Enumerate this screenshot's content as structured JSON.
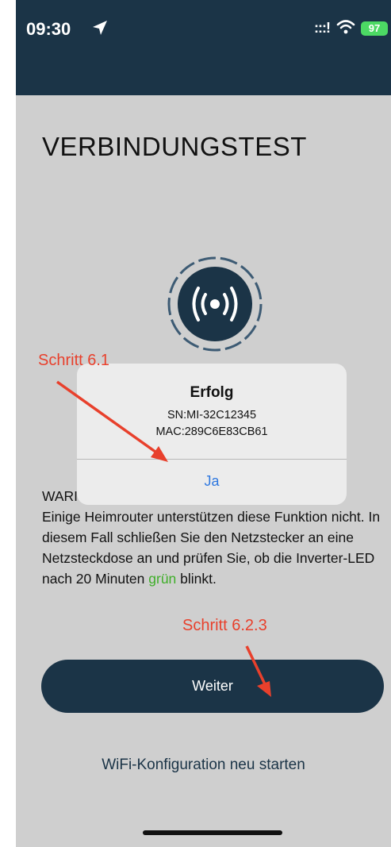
{
  "status_bar": {
    "time": "09:30",
    "signal": ":::!",
    "battery": "97"
  },
  "page": {
    "title": "VERBINDUNGSTEST"
  },
  "annotations": {
    "step_1": "Schritt 6.1",
    "step_2": "Schritt 6.2.3"
  },
  "dialog": {
    "title": "Erfolg",
    "sn": "SN:MI-32C12345",
    "mac": "MAC:289C6E83CB61",
    "confirm_label": "Ja"
  },
  "warning": {
    "label": "WARI",
    "text_before": "Einige Heimrouter unterstützen diese Funktion nicht. In diesem Fall schließen Sie den Netzstecker an eine Netzsteckdose an und prüfen Sie, ob die Inverter-LED nach 20 Minuten ",
    "green_word": "grün",
    "text_after": " blinkt."
  },
  "buttons": {
    "next_label": "Weiter",
    "restart_label": "WiFi-Konfiguration neu starten"
  },
  "colors": {
    "brand_dark": "#1b3447",
    "annotation_red": "#e8402c",
    "dialog_button_blue": "#2f78e0",
    "success_green": "#3fae29",
    "battery_green": "#4cd964"
  },
  "icons": {
    "status": [
      "location-arrow-icon",
      "cellular-signal-icon",
      "wifi-icon",
      "battery-icon"
    ],
    "center": "wireless-broadcast-icon"
  }
}
